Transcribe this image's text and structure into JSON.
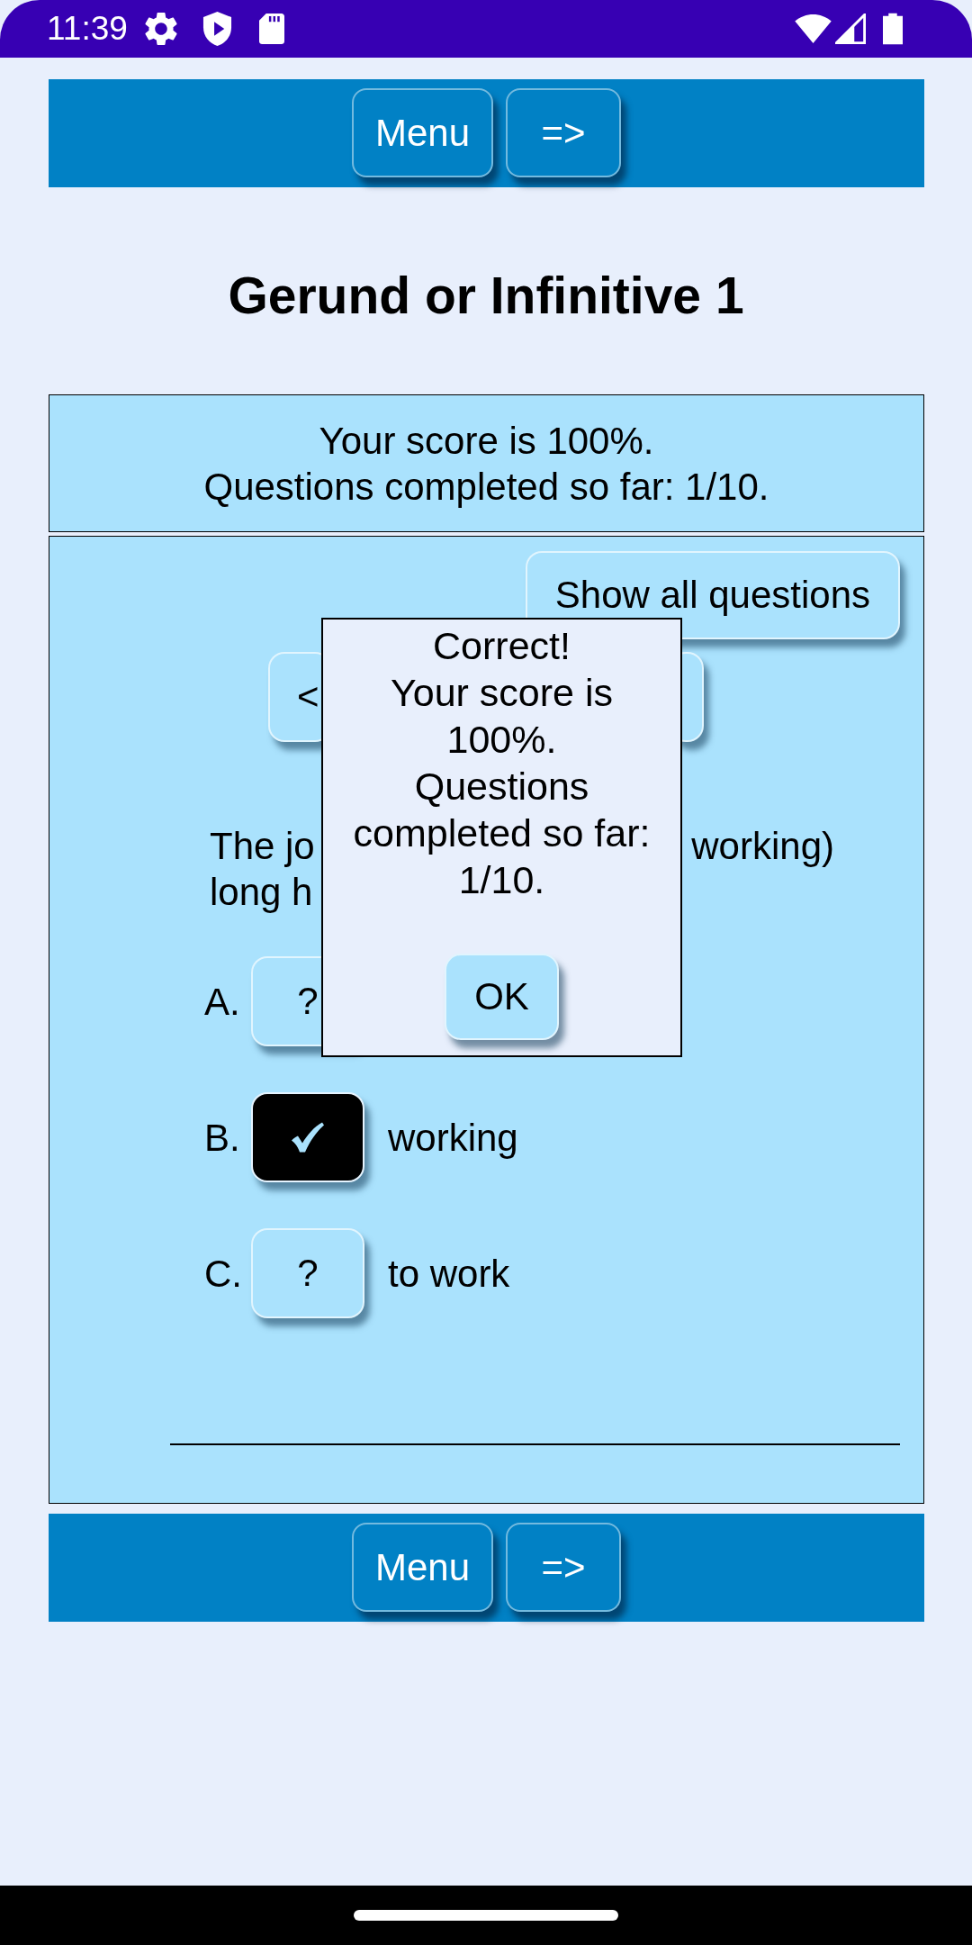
{
  "status_bar": {
    "time": "11:39"
  },
  "top_toolbar": {
    "buttons": [
      "Menu",
      "=>"
    ]
  },
  "title": "Gerund or Infinitive 1",
  "score_panel": {
    "lines": [
      "Your score is 100%.",
      "Questions completed so far: 1/10."
    ]
  },
  "quiz_panel": {
    "show_all_button": "Show all questions",
    "nav_buttons": [
      {
        "kind": "previous",
        "label": "<"
      },
      {
        "kind": "next"
      }
    ],
    "question_lines": [
      {
        "left": "The jo",
        "right": "working)"
      },
      {
        "left": "long h"
      }
    ],
    "options": [
      {
        "letter": "A.",
        "selected": false,
        "mark": "?"
      },
      {
        "letter": "B.",
        "selected": true,
        "answer": "working"
      },
      {
        "letter": "C.",
        "selected": false,
        "mark": "?",
        "answer": "to work"
      }
    ],
    "dialog": {
      "message": "Correct!\nYour score is 100%.\nQuestions completed so far: 1/10.",
      "button": "OK"
    }
  },
  "bottom_toolbar": {
    "buttons": [
      "Menu",
      "=>"
    ]
  }
}
